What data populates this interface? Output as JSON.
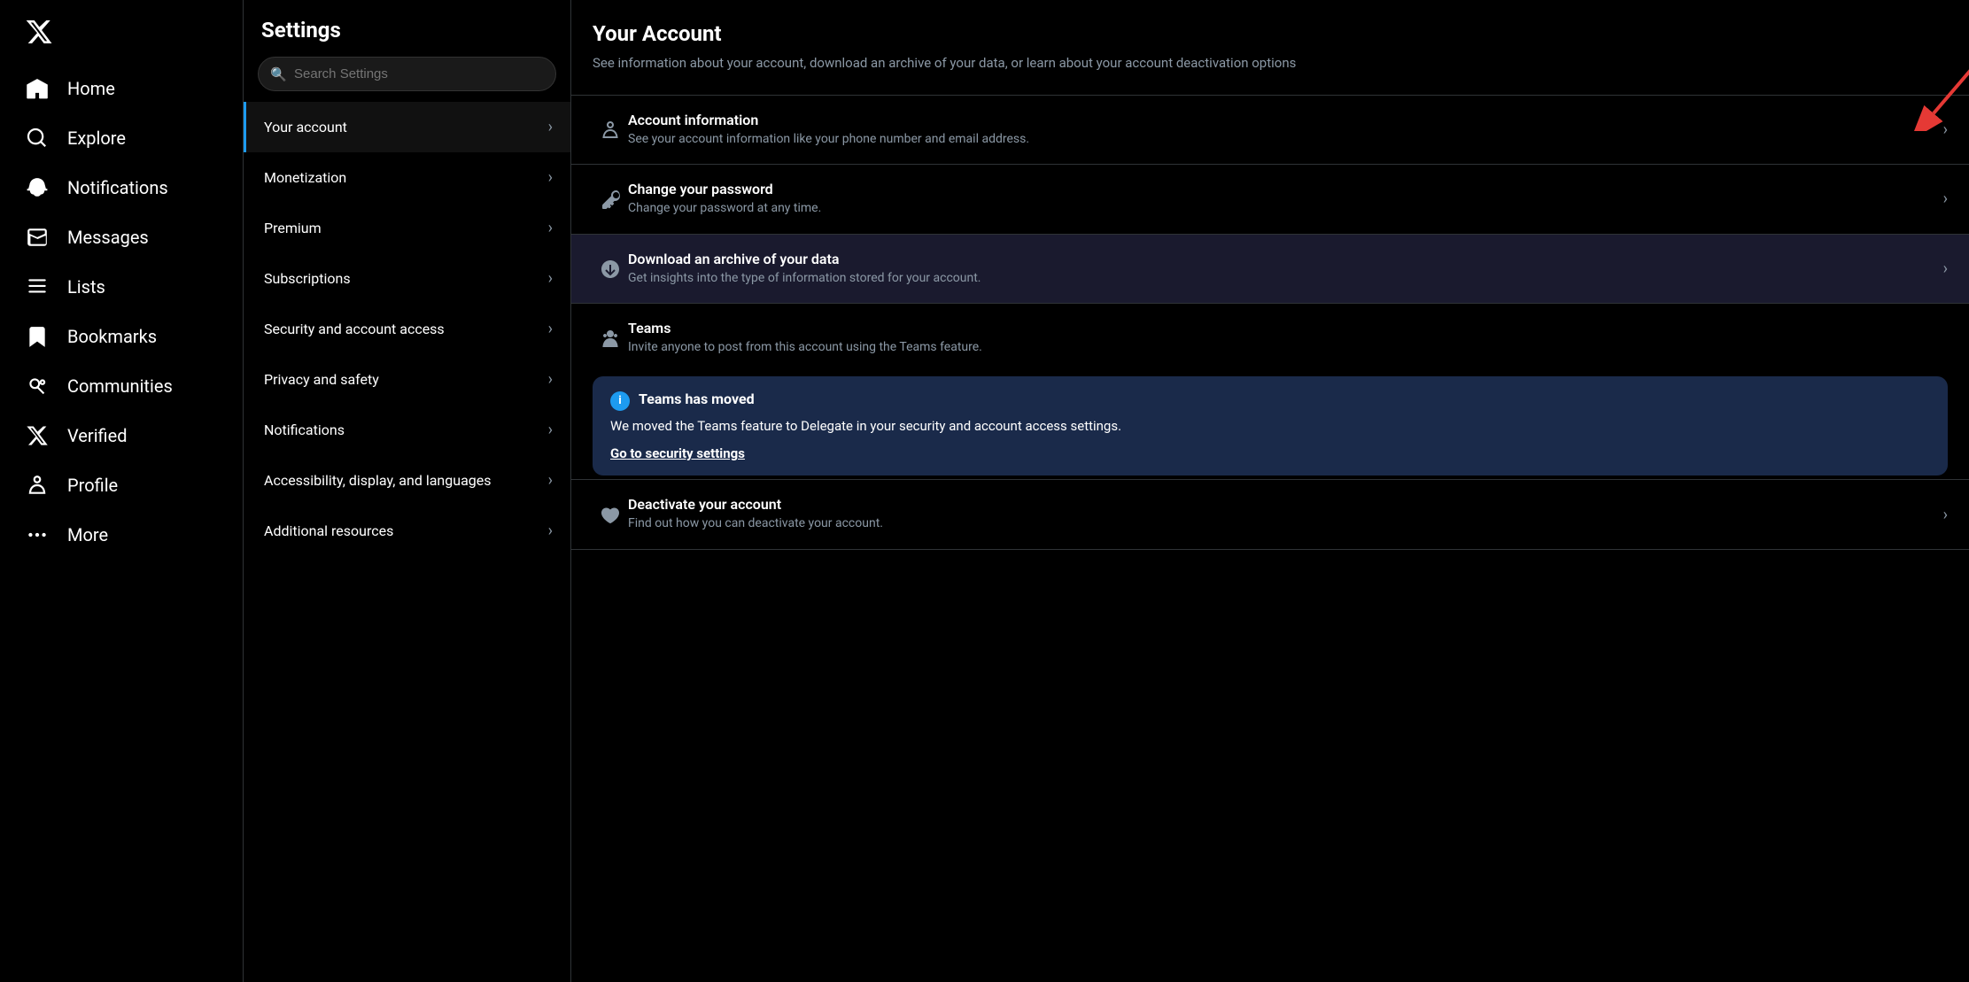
{
  "sidebar": {
    "logo_label": "X",
    "items": [
      {
        "id": "home",
        "label": "Home",
        "icon": "home"
      },
      {
        "id": "explore",
        "label": "Explore",
        "icon": "explore"
      },
      {
        "id": "notifications",
        "label": "Notifications",
        "icon": "bell"
      },
      {
        "id": "messages",
        "label": "Messages",
        "icon": "mail"
      },
      {
        "id": "lists",
        "label": "Lists",
        "icon": "list"
      },
      {
        "id": "bookmarks",
        "label": "Bookmarks",
        "icon": "bookmark"
      },
      {
        "id": "communities",
        "label": "Communities",
        "icon": "people"
      },
      {
        "id": "verified",
        "label": "Verified",
        "icon": "x"
      },
      {
        "id": "profile",
        "label": "Profile",
        "icon": "person"
      },
      {
        "id": "more",
        "label": "More",
        "icon": "more"
      }
    ]
  },
  "settings": {
    "title": "Settings",
    "search_placeholder": "Search Settings",
    "menu_items": [
      {
        "id": "your-account",
        "label": "Your account",
        "active": true
      },
      {
        "id": "monetization",
        "label": "Monetization",
        "active": false
      },
      {
        "id": "premium",
        "label": "Premium",
        "active": false
      },
      {
        "id": "subscriptions",
        "label": "Subscriptions",
        "active": false
      },
      {
        "id": "security",
        "label": "Security and account access",
        "active": false
      },
      {
        "id": "privacy",
        "label": "Privacy and safety",
        "active": false
      },
      {
        "id": "notifications",
        "label": "Notifications",
        "active": false
      },
      {
        "id": "accessibility",
        "label": "Accessibility, display, and languages",
        "active": false
      },
      {
        "id": "resources",
        "label": "Additional resources",
        "active": false
      }
    ]
  },
  "content": {
    "title": "Your Account",
    "subtitle": "See information about your account, download an archive of your data, or learn about your account deactivation options",
    "rows": [
      {
        "id": "account-info",
        "icon": "person",
        "title": "Account information",
        "description": "See your account information like your phone number and email address.",
        "highlighted": false
      },
      {
        "id": "change-password",
        "icon": "key",
        "title": "Change your password",
        "description": "Change your password at any time.",
        "highlighted": false
      },
      {
        "id": "download-archive",
        "icon": "download",
        "title": "Download an archive of your data",
        "description": "Get insights into the type of information stored for your account.",
        "highlighted": true
      },
      {
        "id": "teams",
        "icon": "people",
        "title": "Teams",
        "description": "Invite anyone to post from this account using the Teams feature.",
        "highlighted": false
      }
    ],
    "teams_banner": {
      "title": "Teams has moved",
      "body": "We moved the Teams feature to Delegate in your security and account access settings.",
      "link_text": "Go to security settings"
    },
    "deactivate_row": {
      "id": "deactivate",
      "icon": "heart",
      "title": "Deactivate your account",
      "description": "Find out how you can deactivate your account.",
      "highlighted": false
    }
  }
}
